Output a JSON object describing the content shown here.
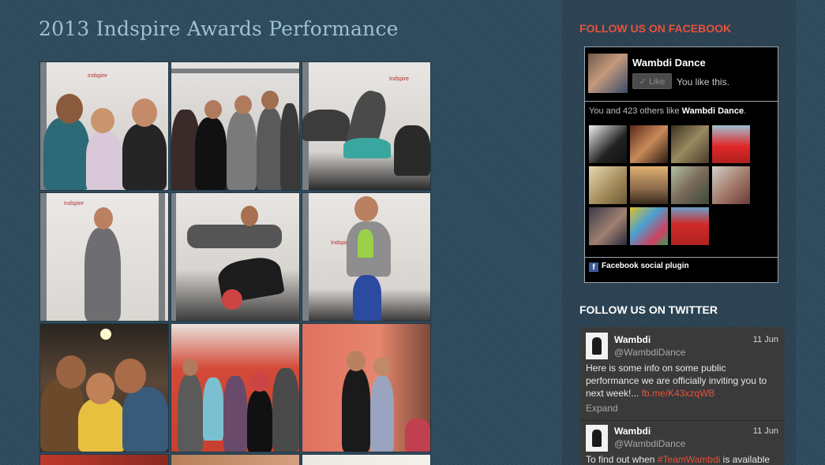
{
  "page_title": "2013 Indspire Awards Performance",
  "gallery": {
    "thumbnails": [
      {
        "label": "photo-1",
        "logo": "Indspire"
      },
      {
        "label": "photo-2",
        "logo": ""
      },
      {
        "label": "photo-3",
        "logo": "Indspire"
      },
      {
        "label": "photo-4",
        "logo": "Indspire"
      },
      {
        "label": "photo-5",
        "logo": "Indspire"
      },
      {
        "label": "photo-6",
        "logo": "Indspire"
      },
      {
        "label": "photo-7",
        "logo": ""
      },
      {
        "label": "photo-8",
        "logo": ""
      },
      {
        "label": "photo-9",
        "logo": ""
      }
    ]
  },
  "facebook": {
    "heading": "FOLLOW US ON FACEBOOK",
    "page_name": "Wambdi Dance",
    "like_button": "✓ Like",
    "like_note": "You like this.",
    "count_prefix": "You and 423 others like ",
    "count_page": "Wambdi Dance",
    "count_suffix": ".",
    "plugin_label": "Facebook social plugin"
  },
  "twitter": {
    "heading": "FOLLOW US ON TWITTER",
    "tweets": [
      {
        "name": "Wambdi",
        "handle": "@WambdiDance",
        "date": "11 Jun",
        "text": "Here is some info on some public performance we are officially inviting you to next week!... ",
        "link": "fb.me/K43xzqWB",
        "expand": "Expand"
      },
      {
        "name": "Wambdi",
        "handle": "@WambdiDance",
        "date": "11 Jun",
        "text_prefix": "To find out when ",
        "hashtag": "#TeamWambdi",
        "text_suffix": " is available"
      }
    ]
  },
  "colors": {
    "background": "#2d4a5c",
    "title": "#9cc0d6",
    "accent_red": "#e8523a"
  }
}
